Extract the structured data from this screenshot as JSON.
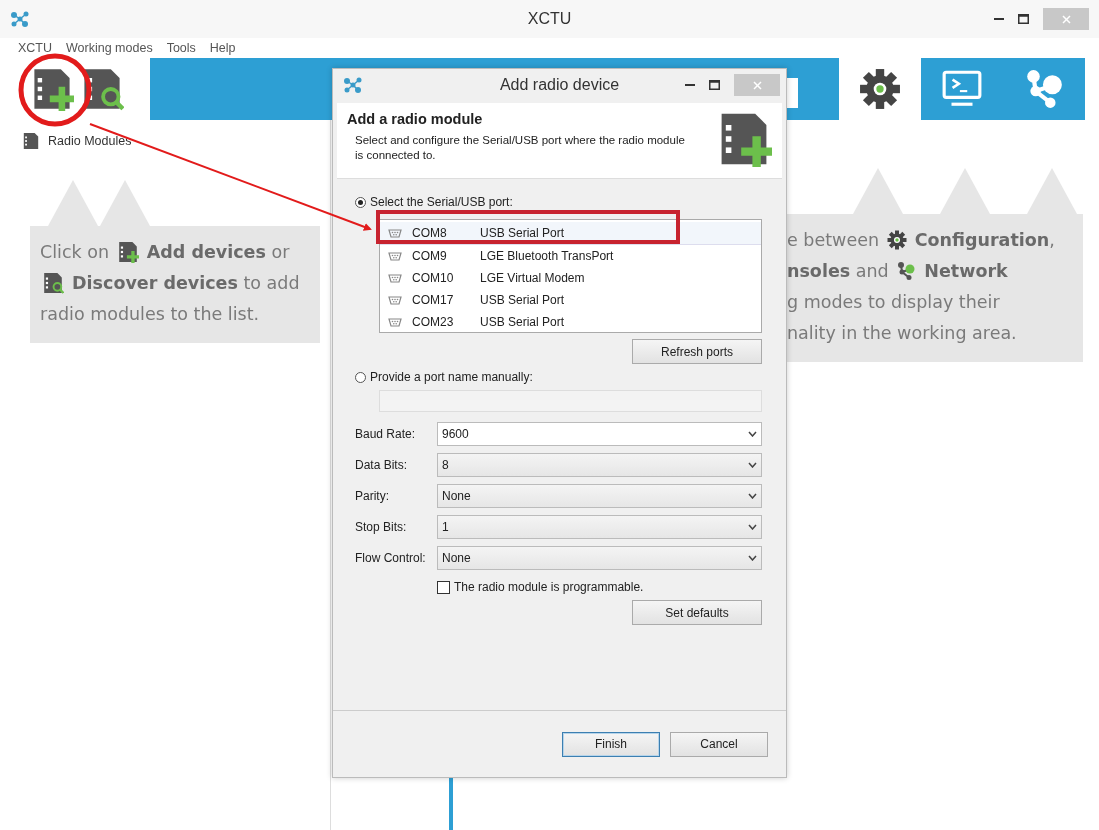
{
  "window": {
    "title": "XCTU"
  },
  "menu": [
    "XCTU",
    "Working modes",
    "Tools",
    "Help"
  ],
  "toolbar": {
    "mode_tabs": [
      {
        "kind": "configuration",
        "selected": true
      },
      {
        "kind": "consoles",
        "selected": false
      },
      {
        "kind": "network",
        "selected": false
      }
    ]
  },
  "sidebar": {
    "title": "Radio Modules"
  },
  "callouts": [
    {
      "lines": [
        [
          {
            "kind": "text",
            "text": "Click on "
          },
          {
            "kind": "add-icon"
          },
          {
            "kind": "bold",
            "text": " Add devices"
          },
          {
            "kind": "text",
            "text": " or"
          }
        ],
        [
          {
            "kind": "discover-icon"
          },
          {
            "kind": "bold",
            "text": " Discover devices"
          },
          {
            "kind": "text",
            "text": " to add"
          }
        ],
        [
          {
            "kind": "text",
            "text": "radio modules to the list."
          }
        ]
      ]
    },
    {
      "lines": [
        [
          {
            "kind": "text",
            "text": "e between "
          },
          {
            "kind": "gear-icon"
          },
          {
            "kind": "bold",
            "text": " Configuration"
          },
          {
            "kind": "text",
            "text": ","
          }
        ],
        [
          {
            "kind": "bold",
            "text": "nsoles"
          },
          {
            "kind": "text",
            "text": " and "
          },
          {
            "kind": "network-icon"
          },
          {
            "kind": "bold",
            "text": " Network"
          }
        ],
        [
          {
            "kind": "text",
            "text": "g modes to display their"
          }
        ],
        [
          {
            "kind": "text",
            "text": "nality in the working area."
          }
        ]
      ]
    }
  ],
  "dialog": {
    "title": "Add radio device",
    "heading": "Add a radio module",
    "description": "Select and configure the Serial/USB port where the radio module is connected to.",
    "port_sources": [
      {
        "label": "Select the Serial/USB port:",
        "selected": true
      },
      {
        "label": "Provide a port name manually:",
        "selected": false
      }
    ],
    "ports": [
      {
        "port": "COM8",
        "description": "USB Serial Port",
        "selected": true
      },
      {
        "port": "COM9",
        "description": "LGE Bluetooth TransPort",
        "selected": false
      },
      {
        "port": "COM10",
        "description": "LGE Virtual Modem",
        "selected": false
      },
      {
        "port": "COM17",
        "description": "USB Serial Port",
        "selected": false
      },
      {
        "port": "COM23",
        "description": "USB Serial Port",
        "selected": false
      }
    ],
    "refresh_button": "Refresh ports",
    "manual_field": {
      "disabled": true
    },
    "settings": [
      {
        "label": "Baud Rate:",
        "value": "9600",
        "editable": true
      },
      {
        "label": "Data Bits:",
        "value": "8",
        "editable": false
      },
      {
        "label": "Parity:",
        "value": "None",
        "editable": false
      },
      {
        "label": "Stop Bits:",
        "value": "1",
        "editable": false
      },
      {
        "label": "Flow Control:",
        "value": "None",
        "editable": false
      }
    ],
    "programmable": {
      "label": "The radio module is programmable.",
      "checked": false
    },
    "set_defaults_button": "Set defaults",
    "buttons": [
      {
        "label": "Finish",
        "default": true
      },
      {
        "label": "Cancel",
        "default": false
      }
    ]
  }
}
